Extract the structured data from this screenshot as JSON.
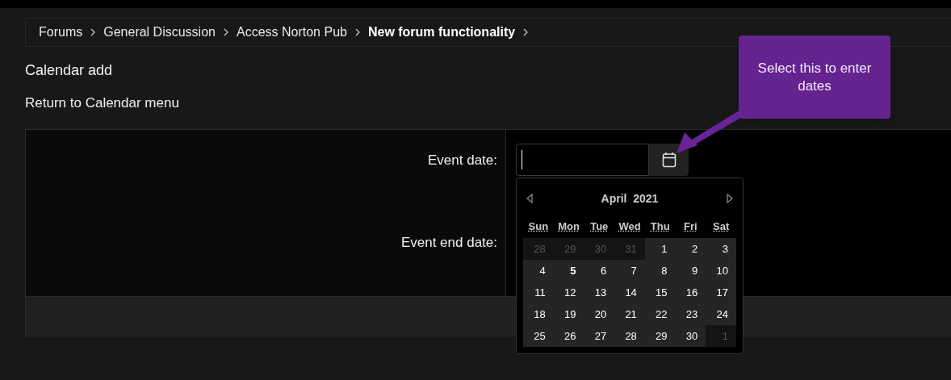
{
  "breadcrumb": [
    {
      "label": "Forums",
      "current": false
    },
    {
      "label": "General Discussion",
      "current": false
    },
    {
      "label": "Access Norton Pub",
      "current": false
    },
    {
      "label": "New forum functionality",
      "current": true
    }
  ],
  "page_title": "Calendar add",
  "return_link": "Return to Calendar menu",
  "form": {
    "fields": [
      {
        "label": "Event date:"
      },
      {
        "label": "Event end date:"
      }
    ]
  },
  "datepicker": {
    "month": "April",
    "year": "2021",
    "weekdays": [
      "Sun",
      "Mon",
      "Tue",
      "Wed",
      "Thu",
      "Fri",
      "Sat"
    ],
    "weeks": [
      [
        {
          "day": "28",
          "other_month": true,
          "today": false
        },
        {
          "day": "29",
          "other_month": true,
          "today": false
        },
        {
          "day": "30",
          "other_month": true,
          "today": false
        },
        {
          "day": "31",
          "other_month": true,
          "today": false
        },
        {
          "day": "1",
          "other_month": false,
          "today": false
        },
        {
          "day": "2",
          "other_month": false,
          "today": false
        },
        {
          "day": "3",
          "other_month": false,
          "today": false
        }
      ],
      [
        {
          "day": "4",
          "other_month": false,
          "today": false
        },
        {
          "day": "5",
          "other_month": false,
          "today": true
        },
        {
          "day": "6",
          "other_month": false,
          "today": false
        },
        {
          "day": "7",
          "other_month": false,
          "today": false
        },
        {
          "day": "8",
          "other_month": false,
          "today": false
        },
        {
          "day": "9",
          "other_month": false,
          "today": false
        },
        {
          "day": "10",
          "other_month": false,
          "today": false
        }
      ],
      [
        {
          "day": "11",
          "other_month": false,
          "today": false
        },
        {
          "day": "12",
          "other_month": false,
          "today": false
        },
        {
          "day": "13",
          "other_month": false,
          "today": false
        },
        {
          "day": "14",
          "other_month": false,
          "today": false
        },
        {
          "day": "15",
          "other_month": false,
          "today": false
        },
        {
          "day": "16",
          "other_month": false,
          "today": false
        },
        {
          "day": "17",
          "other_month": false,
          "today": false
        }
      ],
      [
        {
          "day": "18",
          "other_month": false,
          "today": false
        },
        {
          "day": "19",
          "other_month": false,
          "today": false
        },
        {
          "day": "20",
          "other_month": false,
          "today": false
        },
        {
          "day": "21",
          "other_month": false,
          "today": false
        },
        {
          "day": "22",
          "other_month": false,
          "today": false
        },
        {
          "day": "23",
          "other_month": false,
          "today": false
        },
        {
          "day": "24",
          "other_month": false,
          "today": false
        }
      ],
      [
        {
          "day": "25",
          "other_month": false,
          "today": false
        },
        {
          "day": "26",
          "other_month": false,
          "today": false
        },
        {
          "day": "27",
          "other_month": false,
          "today": false
        },
        {
          "day": "28",
          "other_month": false,
          "today": false
        },
        {
          "day": "29",
          "other_month": false,
          "today": false
        },
        {
          "day": "30",
          "other_month": false,
          "today": false
        },
        {
          "day": "1",
          "other_month": true,
          "today": false
        }
      ]
    ]
  },
  "callout": {
    "text": "Select this to enter dates"
  }
}
